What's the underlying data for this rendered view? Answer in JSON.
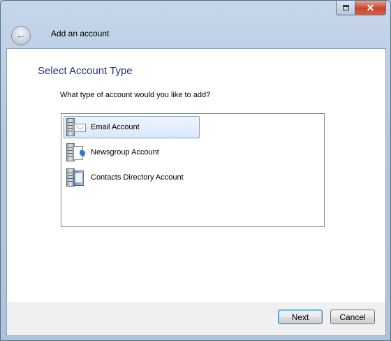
{
  "window": {
    "title": "Add an account",
    "close_glyph": "✕",
    "back_glyph": "←"
  },
  "page": {
    "heading": "Select Account Type",
    "question": "What type of account would you like to add?"
  },
  "account_types": [
    {
      "label": "Email Account",
      "icon": "email-server-icon",
      "selected": true
    },
    {
      "label": "Newsgroup Account",
      "icon": "newsgroup-server-icon",
      "selected": false
    },
    {
      "label": "Contacts Directory Account",
      "icon": "directory-server-icon",
      "selected": false
    }
  ],
  "buttons": {
    "next": "Next",
    "cancel": "Cancel"
  },
  "colors": {
    "heading": "#1e3287",
    "selection_border": "#7da2ce",
    "close_button": "#c7462f"
  }
}
